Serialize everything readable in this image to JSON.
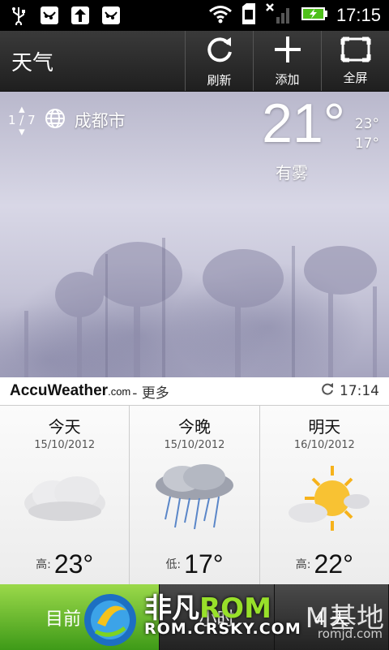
{
  "status_bar": {
    "time": "17:15"
  },
  "app_bar": {
    "title": "天气",
    "actions": [
      {
        "label": "刷新",
        "icon": "refresh-icon"
      },
      {
        "label": "添加",
        "icon": "plus-icon"
      },
      {
        "label": "全屏",
        "icon": "fullscreen-icon"
      }
    ]
  },
  "location": {
    "pager": "1 / 7",
    "city": "成都市"
  },
  "current": {
    "temp": "21°",
    "high": "23°",
    "low": "17°",
    "condition": "有雾"
  },
  "provider": {
    "name": "AccuWeather",
    "domain": ".com",
    "more": "- 更多",
    "updated": "17:14"
  },
  "forecast": [
    {
      "day": "今天",
      "date": "15/10/2012",
      "label": "高:",
      "temp": "23°",
      "icon": "fog-icon"
    },
    {
      "day": "今晚",
      "date": "15/10/2012",
      "label": "低:",
      "temp": "17°",
      "icon": "rain-icon"
    },
    {
      "day": "明天",
      "date": "16/10/2012",
      "label": "高:",
      "temp": "22°",
      "icon": "sun-cloud-icon"
    }
  ],
  "tabs": [
    {
      "label": "目前"
    },
    {
      "label": "小时"
    },
    {
      "label": "4 天"
    }
  ],
  "watermark": {
    "brand_a": "非凡",
    "brand_b": "ROM",
    "url": "ROM.CRSKY.COM",
    "right": "M基地",
    "right_url": "romjd.com"
  },
  "colors": {
    "accent_green": "#58b41f",
    "sun": "#f6b21b"
  }
}
